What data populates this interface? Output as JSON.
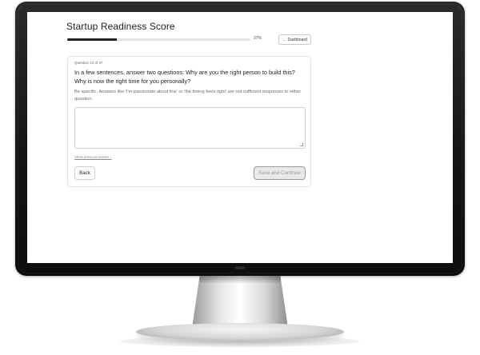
{
  "app": {
    "title": "Startup Readiness Score",
    "progress": {
      "percent": 27,
      "label": "27%"
    },
    "dashboard_button": {
      "arrow": "←",
      "label": "Dashboard"
    }
  },
  "question": {
    "counter": "Question 10 of 37",
    "text": "In a few sentences, answer two questions: Why are you the right person to build this? Why is now the right time for you personally?",
    "hint": "Be specific. Answers like 'I'm passionate about this' or 'the timing feels right' are not sufficient responses to either question.",
    "answer_value": "",
    "show_previous": "Show previous answer ↓"
  },
  "actions": {
    "back_label": "Back",
    "save_label": "Save and Continue"
  },
  "colors": {
    "accent": "#222222",
    "track": "#e4e4e4",
    "disabled_text": "#9a9a9a"
  }
}
